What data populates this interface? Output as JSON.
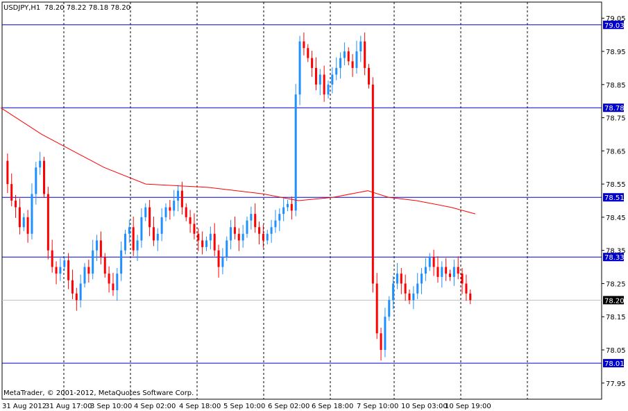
{
  "header": {
    "symbol_timeframe": "USDJPY,H1",
    "ohlc": "78.20 78.22 78.18 78.20"
  },
  "footer": {
    "copyright": "MetaTrader, © 2001-2012, MetaQuotes Software Corp."
  },
  "colors": {
    "background": "#ffffff",
    "frame": "#000000",
    "grid": "#000000",
    "bull": "#1e90ff",
    "bear": "#ff0000",
    "moving_average": "#ff0000",
    "level_line": "#0000cd",
    "price_line": "#c0c0c0",
    "label_text": "#ffffff"
  },
  "chart_data": {
    "type": "candlestick",
    "ylim": [
      77.9,
      79.1
    ],
    "y_ticks": [
      "79.05",
      "78.95",
      "78.85",
      "78.75",
      "78.65",
      "78.55",
      "78.45",
      "78.35",
      "78.25",
      "78.15",
      "78.05",
      "77.95"
    ],
    "x_ticks": [
      "31 Aug 2012",
      "31 Aug 17:00",
      "3 Sep 10:00",
      "4 Sep 02:00",
      "4 Sep 18:00",
      "5 Sep 10:00",
      "6 Sep 02:00",
      "6 Sep 18:00",
      "7 Sep 10:00",
      "10 Sep 03:00",
      "10 Sep 19:00"
    ],
    "levels": [
      {
        "label": "79.03",
        "value": 79.03
      },
      {
        "label": "78.78",
        "value": 78.78
      },
      {
        "label": "78.51",
        "value": 78.51
      },
      {
        "label": "78.33",
        "value": 78.33
      },
      {
        "label": "78.01",
        "value": 78.01
      }
    ],
    "current_price": {
      "label": "78.20",
      "value": 78.2
    },
    "price_sequence": [
      78.62,
      78.55,
      78.5,
      78.48,
      78.42,
      78.45,
      78.4,
      78.52,
      78.6,
      78.62,
      78.52,
      78.35,
      78.3,
      78.28,
      78.3,
      78.32,
      78.26,
      78.22,
      78.2,
      78.25,
      78.3,
      78.28,
      78.35,
      78.38,
      78.33,
      78.28,
      78.25,
      78.23,
      78.28,
      78.35,
      78.4,
      78.42,
      78.35,
      78.38,
      78.45,
      78.48,
      78.42,
      78.38,
      78.4,
      78.45,
      78.48,
      78.47,
      78.5,
      78.53,
      78.48,
      78.45,
      78.43,
      78.4,
      78.38,
      78.36,
      78.38,
      78.4,
      78.35,
      78.3,
      78.33,
      78.38,
      78.42,
      78.4,
      78.38,
      78.4,
      78.44,
      78.46,
      78.42,
      78.4,
      78.38,
      78.4,
      78.42,
      78.44,
      78.46,
      78.48,
      78.49,
      78.47,
      78.82,
      78.98,
      78.96,
      78.93,
      78.9,
      78.85,
      78.88,
      78.82,
      78.85,
      78.88,
      78.9,
      78.93,
      78.95,
      78.92,
      78.9,
      78.95,
      78.98,
      78.9,
      78.85,
      78.25,
      78.1,
      78.05,
      78.15,
      78.2,
      78.25,
      78.28,
      78.25,
      78.22,
      78.2,
      78.22,
      78.25,
      78.28,
      78.3,
      78.33,
      78.3,
      78.27,
      78.3,
      78.28,
      78.27,
      78.3,
      78.28,
      78.25,
      78.22,
      78.2
    ],
    "moving_average": [
      [
        1,
        78.78
      ],
      [
        60,
        78.7
      ],
      [
        150,
        78.6
      ],
      [
        210,
        78.55
      ],
      [
        300,
        78.54
      ],
      [
        380,
        78.52
      ],
      [
        430,
        78.5
      ],
      [
        480,
        78.51
      ],
      [
        530,
        78.53
      ],
      [
        560,
        78.51
      ],
      [
        600,
        78.5
      ],
      [
        650,
        78.48
      ],
      [
        685,
        78.46
      ]
    ]
  }
}
